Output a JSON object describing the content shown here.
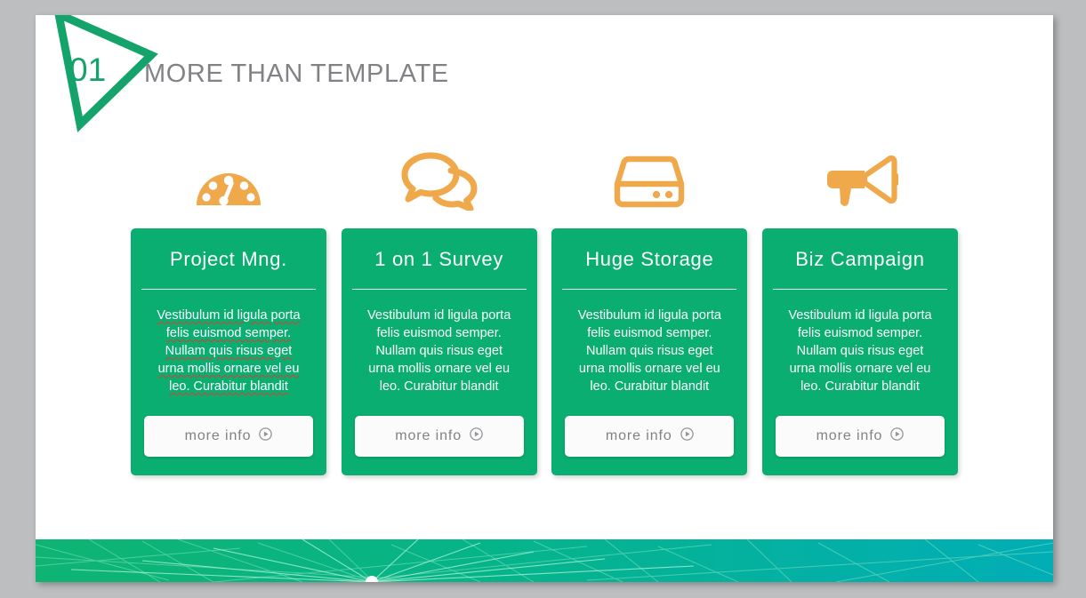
{
  "slide": {
    "number": "01",
    "title": "MORE THAN TEMPLATE"
  },
  "colors": {
    "green": "#0BAE71",
    "green_dark": "#14A36B",
    "orange": "#EFA84A",
    "title_gray": "#808285",
    "band_left": "#0FB472",
    "band_right": "#02AEB6",
    "background_gray": "#BCBEC0"
  },
  "body_text": {
    "line1": "Vestibulum id ligula porta",
    "line2": "felis euismod semper.",
    "line3": "Nullam quis risus eget",
    "line4": "urna mollis ornare vel eu",
    "line5": "leo. Curabitur blandit"
  },
  "columns": [
    {
      "icon": "speedometer-icon",
      "title": "Project Mng.",
      "button_label": "more info",
      "button_icon": "play-circle-icon",
      "spellcheck": true
    },
    {
      "icon": "speech-bubbles-icon",
      "title": "1 on 1 Survey",
      "button_label": "more info",
      "button_icon": "play-circle-icon",
      "spellcheck": false
    },
    {
      "icon": "hard-drive-icon",
      "title": "Huge Storage",
      "button_label": "more info",
      "button_icon": "play-circle-icon",
      "spellcheck": false
    },
    {
      "icon": "megaphone-icon",
      "title": "Biz Campaign",
      "button_label": "more info",
      "button_icon": "play-circle-icon",
      "spellcheck": false
    }
  ]
}
